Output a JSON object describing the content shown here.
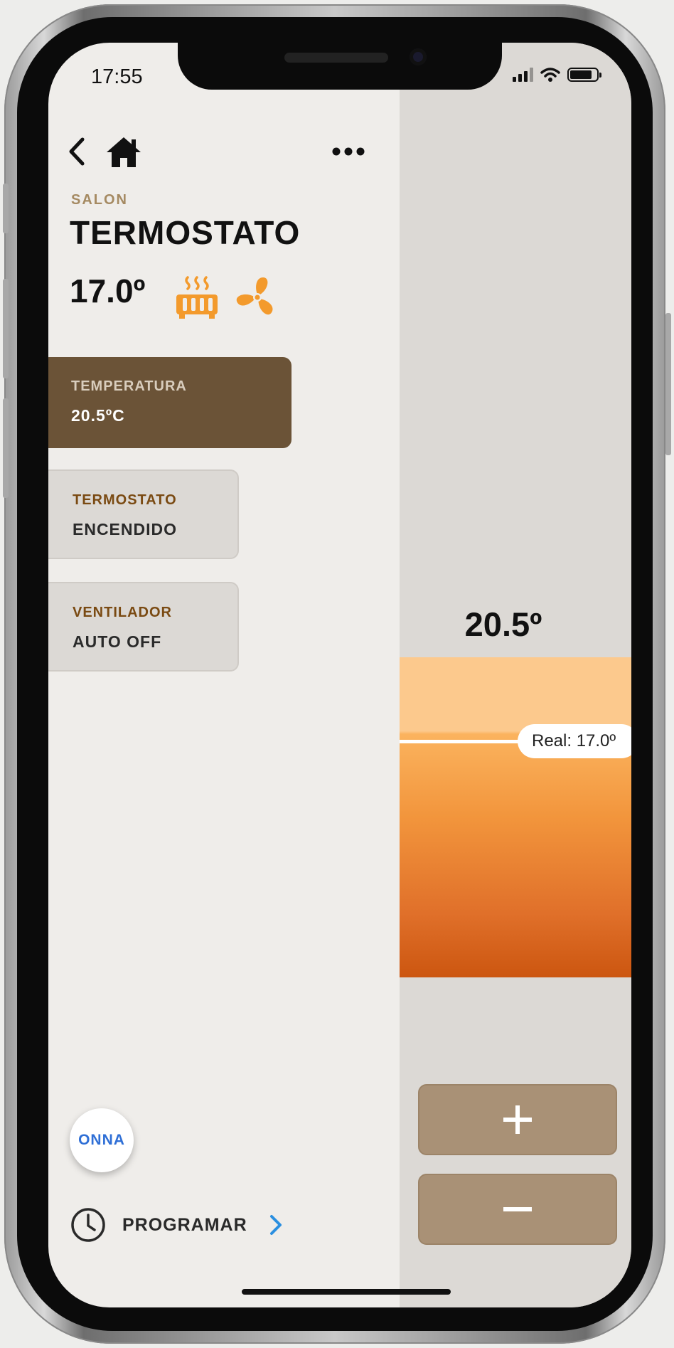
{
  "status_bar": {
    "time": "17:55"
  },
  "header": {
    "room": "SALON",
    "title": "TERMOSTATO"
  },
  "current": {
    "temperature": "17.0º"
  },
  "cards": {
    "temperatura": {
      "label": "TEMPERATURA",
      "value": "20.5ºC"
    },
    "termostato": {
      "label": "TERMOSTATO",
      "value": "ENCENDIDO"
    },
    "ventilador": {
      "label": "VENTILADOR",
      "value": "AUTO OFF"
    }
  },
  "slider": {
    "setpoint": "20.5º",
    "real_label": "Real: 17.0º"
  },
  "schedule": {
    "label": "PROGRAMAR"
  },
  "logo": {
    "text": "ONNA"
  },
  "colors": {
    "accent_orange": "#f2953c",
    "card_active": "#6b5337",
    "card_label": "#7a4a12",
    "control_button": "#a99176",
    "link_blue": "#2b8fe0"
  },
  "icons": [
    "back-arrow-icon",
    "home-icon",
    "more-icon",
    "heater-icon",
    "fan-icon",
    "plus-icon",
    "minus-icon",
    "clock-icon",
    "chevron-right-icon",
    "signal-icon",
    "wifi-icon",
    "battery-icon"
  ]
}
